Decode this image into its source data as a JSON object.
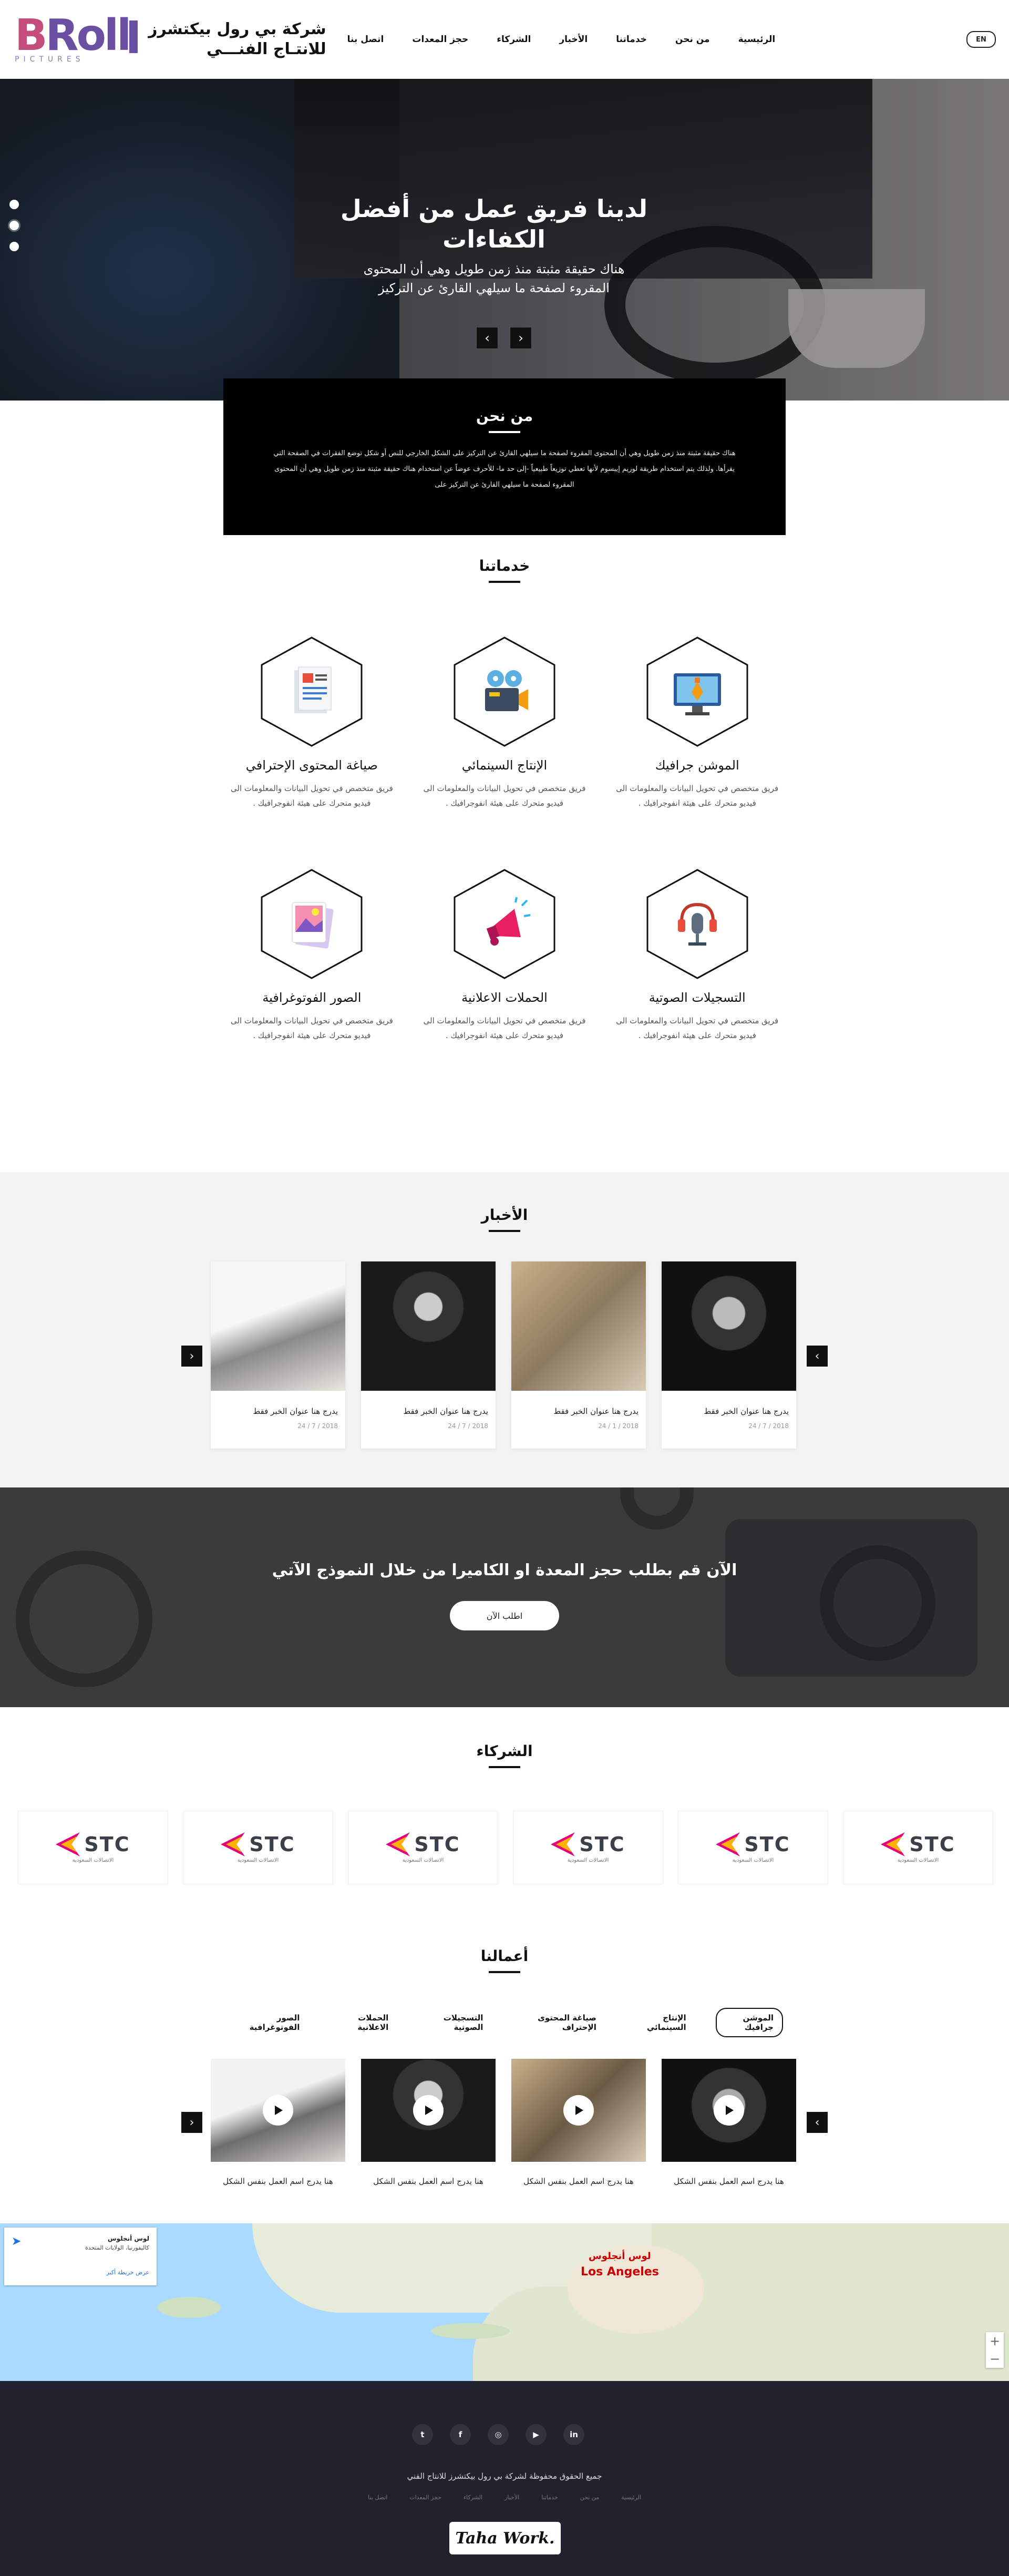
{
  "header": {
    "logo_letters": "Roll",
    "logo_b": "B",
    "logo_sub": "PICTURES",
    "logo_text_line1": "شركة بي رول بيكتشرز",
    "logo_text_line2": "للانتـاج الفنـــي",
    "nav": [
      "الرئيسية",
      "من نحن",
      "خدماتنا",
      "الأخبار",
      "الشركاء",
      "حجز المعدات",
      "اتصل بنا"
    ],
    "lang": "EN"
  },
  "hero": {
    "title": "لدينا فريق عمل من أفضل الكفاءات",
    "subtitle_line1": "هناك حقيقة مثبتة منذ زمن طويل وهي أن المحتوى",
    "subtitle_line2": "المقروء لصفحة ما سيلهي القارئ عن التركيز",
    "prev": "‹",
    "next": "›"
  },
  "about": {
    "title": "من نحن",
    "body": "هناك حقيقة مثبتة منذ زمن طويل وهي أن المحتوى المقروء لصفحة ما سيلهي القارئ عن التركيز على الشكل الخارجي للنص أو شكل توضع الفقرات في الصفحة التي يقرأها. ولذلك يتم استخدام طريقة لوريم إيبسوم لأنها تعطي توزيعاً طبيعياً -إلى حد ما- للأحرف عوضاً عن استخدام هناك حقيقة مثبتة منذ زمن طويل وهي أن المحتوى المقروء لصفحة ما سيلهي القارئ عن التركيز على"
  },
  "services": {
    "title": "خدماتنا",
    "desc": "فريق متخصص في تحويل البيانات والمعلومات الى فيديو متحرك على هيئة انفوجرافيك .",
    "items": [
      {
        "title": "الموشن جرافيك",
        "icon": "monitor-pen-icon"
      },
      {
        "title": "الإنتاج السينمائي",
        "icon": "movie-camera-icon"
      },
      {
        "title": "صياغة المحتوى الإحترافي",
        "icon": "document-icon"
      },
      {
        "title": "التسجيلات الصوتية",
        "icon": "microphone-icon"
      },
      {
        "title": "الحملات الاعلانية",
        "icon": "megaphone-icon"
      },
      {
        "title": "الصور الفوتوغرافية",
        "icon": "photo-icon"
      }
    ]
  },
  "news": {
    "title": "الأخبار",
    "items": [
      {
        "caption": "يدرج هنا عنوان الخبر فقط",
        "date": "2018 / 7 / 24"
      },
      {
        "caption": "يدرج هنا عنوان الخبر فقط",
        "date": "2018 / 1 / 24"
      },
      {
        "caption": "يدرج هنا عنوان الخبر فقط",
        "date": "2018 / 7 / 24"
      },
      {
        "caption": "يدرج هنا عنوان الخبر فقط",
        "date": "2018 / 7 / 24"
      }
    ]
  },
  "cta": {
    "text": "الآن قم بطلب حجز المعدة او الكاميرا من خلال النموذج الآتي",
    "button": "اطلب الآن"
  },
  "partners": {
    "title": "الشركاء",
    "logo_text": "STC",
    "logo_sub": "الاتصالات السعودية",
    "count": 6
  },
  "works": {
    "title": "أعمالنا",
    "tabs": [
      "الموشن جرافيك",
      "الإنتاج السينمائي",
      "صياغة المحتوى الإحتراف",
      "التسجيلات الصوتية",
      "الحملات الاعلانية",
      "الصور الفوتوغرافية"
    ],
    "active_tab": 0,
    "caption": "هنا يدرج اسم العمل بنفس الشكل"
  },
  "map": {
    "card_title": "لوس أنجلوس",
    "card_sub": "كاليفورنيا، الولايات المتحدة",
    "card_link": "عرض خريطة أكبر",
    "label_en": "Los Angeles",
    "label_ar": "لوس أنجلوس",
    "zoom_in": "+",
    "zoom_out": "−"
  },
  "footer": {
    "socials": [
      "twitter-icon",
      "facebook-icon",
      "instagram-icon",
      "youtube-icon",
      "linkedin-icon"
    ],
    "social_glyphs": [
      "t",
      "f",
      "◎",
      "▶",
      "in"
    ],
    "copyright": "جميع الحقوق محفوظة لشركة بي رول بيكتشرز للانتاج الفني",
    "nav": [
      "الرئيسية",
      "من نحن",
      "خدماتنا",
      "الأخبار",
      "الشركاء",
      "حجز المعدات",
      "اتصل بنا"
    ],
    "badge": "Taha Work."
  },
  "colors": {
    "brand_purple": "#6a4fa3",
    "brand_pink": "#c44d7d",
    "footer_bg": "#22222f",
    "news_bg": "#f3f3f3"
  }
}
